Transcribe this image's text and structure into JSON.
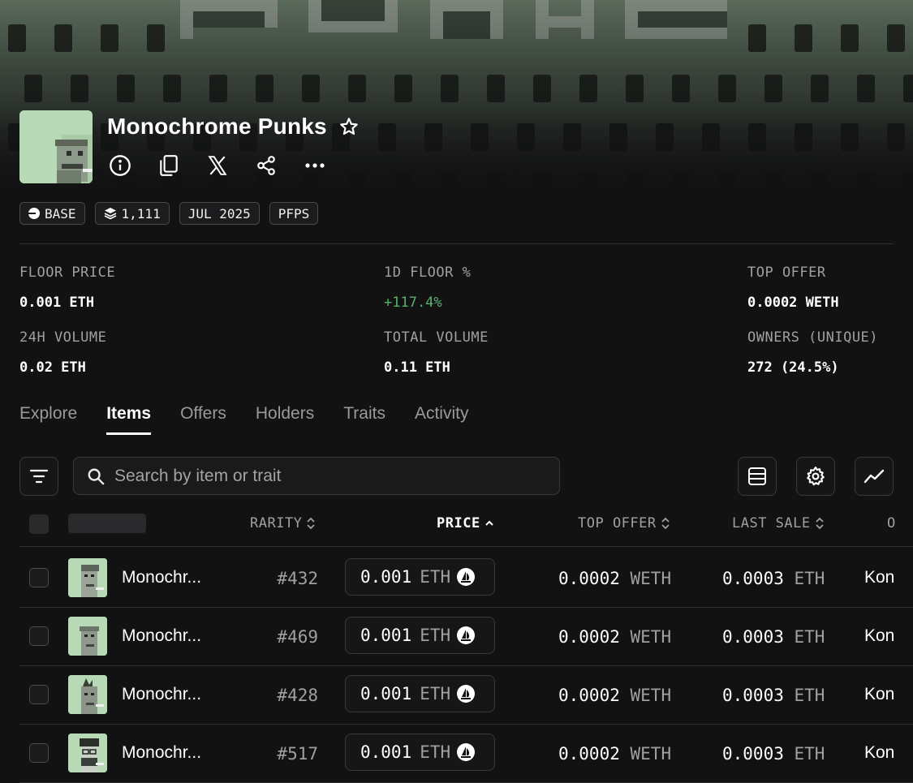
{
  "collection": {
    "name": "Monochrome Punks",
    "tags": [
      {
        "icon": "base-chain-icon",
        "label": "BASE"
      },
      {
        "icon": "layers-icon",
        "label": "1,111"
      },
      {
        "icon": "",
        "label": "JUL 2025"
      },
      {
        "icon": "",
        "label": "PFPS"
      }
    ],
    "actions": [
      "info-icon",
      "copy-icon",
      "x-logo-icon",
      "share-icon",
      "more-icon"
    ]
  },
  "stats": [
    {
      "label": "FLOOR PRICE",
      "value": "0.001 ETH"
    },
    {
      "label": "1D FLOOR %",
      "value": "+117.4%",
      "color": "#56b26a"
    },
    {
      "label": "TOP OFFER",
      "value": "0.0002 WETH"
    },
    {
      "label": "24H VOLUME",
      "value": "0.02 ETH"
    },
    {
      "label": "TOTAL VOLUME",
      "value": "0.11 ETH"
    },
    {
      "label": "OWNERS (UNIQUE)",
      "value": "272 (24.5%)"
    }
  ],
  "tabs": [
    "Explore",
    "Items",
    "Offers",
    "Holders",
    "Traits",
    "Activity"
  ],
  "active_tab": "Items",
  "search": {
    "placeholder": "Search by item or trait"
  },
  "table": {
    "headers": {
      "rarity": "RARITY",
      "price": "PRICE",
      "top_offer": "TOP OFFER",
      "last_sale": "LAST SALE",
      "owner": "O"
    },
    "rows": [
      {
        "name": "Monochr...",
        "rarity": "#432",
        "price": "0.001",
        "price_unit": "ETH",
        "top_offer": "0.0002",
        "top_offer_unit": "WETH",
        "last_sale": "0.0003",
        "last_sale_unit": "ETH",
        "owner": "Kon"
      },
      {
        "name": "Monochr...",
        "rarity": "#469",
        "price": "0.001",
        "price_unit": "ETH",
        "top_offer": "0.0002",
        "top_offer_unit": "WETH",
        "last_sale": "0.0003",
        "last_sale_unit": "ETH",
        "owner": "Kon"
      },
      {
        "name": "Monochr...",
        "rarity": "#428",
        "price": "0.001",
        "price_unit": "ETH",
        "top_offer": "0.0002",
        "top_offer_unit": "WETH",
        "last_sale": "0.0003",
        "last_sale_unit": "ETH",
        "owner": "Kon"
      },
      {
        "name": "Monochr...",
        "rarity": "#517",
        "price": "0.001",
        "price_unit": "ETH",
        "top_offer": "0.0002",
        "top_offer_unit": "WETH",
        "last_sale": "0.0003",
        "last_sale_unit": "ETH",
        "owner": "Kon"
      }
    ]
  },
  "colors": {
    "background": "#121213",
    "positive": "#56b26a",
    "avatar_bg": "#b7d9b5"
  }
}
